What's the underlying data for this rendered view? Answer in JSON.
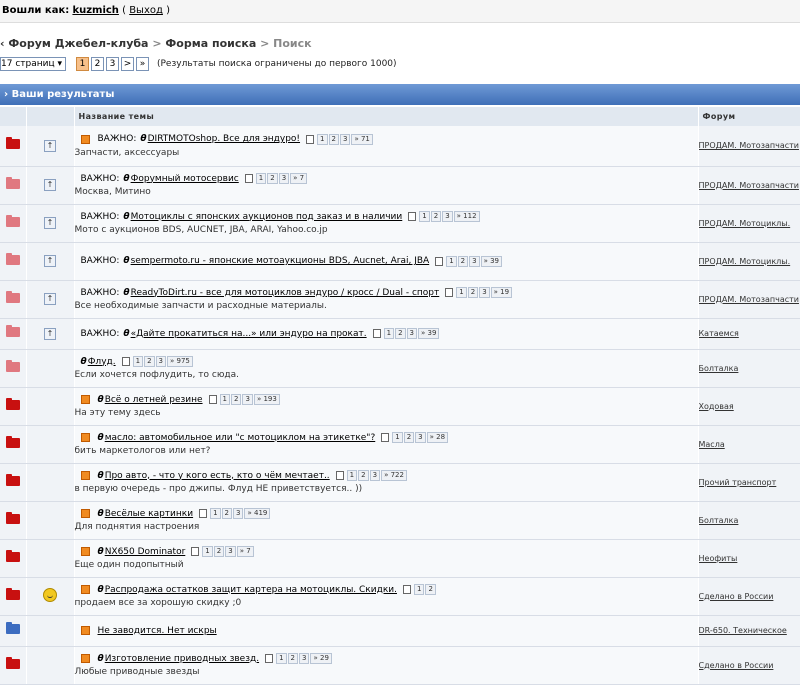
{
  "login": {
    "prefix": "Вошли как:",
    "user": "kuzmich",
    "logout": "Выход"
  },
  "breadcrumb": {
    "lead": "‹ ",
    "items": [
      "Форум Джебел-клуба",
      "Форма поиска"
    ],
    "current": "Поиск"
  },
  "pager": {
    "select_label": "17 страниц ▾",
    "pages": [
      "1",
      "2",
      "3",
      ">",
      "»"
    ],
    "current": "1",
    "note": "(Результаты поиска ограничены до первого 1000)"
  },
  "results": {
    "header": "› Ваши результаты"
  },
  "table": {
    "col_topic": "Название темы",
    "col_forum": "Форум"
  },
  "topics": [
    {
      "icon": "hot",
      "mark": "sticky",
      "new": true,
      "prefix": "ВАЖНО:",
      "poll": true,
      "title": "DIRTMOTOshop. Все для эндуро!",
      "pages": [
        "1",
        "2",
        "3",
        "» 71"
      ],
      "desc": "Запчасти, аксессуары",
      "forum": "ПРОДАМ. Мотозапчасти"
    },
    {
      "icon": "pink",
      "mark": "sticky",
      "new": false,
      "prefix": "ВАЖНО:",
      "poll": true,
      "title": "Форумный мотосервис",
      "pages": [
        "1",
        "2",
        "3",
        "» 7"
      ],
      "desc": "Москва, Митино",
      "forum": "ПРОДАМ. Мотозапчасти"
    },
    {
      "icon": "pink",
      "mark": "sticky",
      "new": false,
      "prefix": "ВАЖНО:",
      "poll": true,
      "title": "Мотоциклы с японских аукционов под заказ и в наличии",
      "pages": [
        "1",
        "2",
        "3",
        "» 112"
      ],
      "desc": "Мото с аукционов BDS, AUCNET, JBA, ARAI, Yahoo.co.jp",
      "forum": "ПРОДАМ. Мотоциклы."
    },
    {
      "icon": "pink",
      "mark": "sticky",
      "new": false,
      "prefix": "ВАЖНО:",
      "poll": true,
      "title": "sempermoto.ru - японские мотоаукционы BDS, Aucnet, Arai, JBA",
      "pages": [
        "1",
        "2",
        "3",
        "» 39"
      ],
      "desc": "",
      "forum": "ПРОДАМ. Мотоциклы."
    },
    {
      "icon": "pink",
      "mark": "sticky",
      "new": false,
      "prefix": "ВАЖНО:",
      "poll": true,
      "title": "ReadyToDirt.ru - все для мотоциклов эндуро / кросс / Dual - спорт",
      "pages": [
        "1",
        "2",
        "3",
        "» 19"
      ],
      "desc": "Все необходимые запчасти и расходные материалы.",
      "forum": "ПРОДАМ. Мотозапчасти"
    },
    {
      "icon": "pink",
      "mark": "sticky",
      "new": false,
      "prefix": "ВАЖНО:",
      "poll": true,
      "title": "«Дайте прокатиться на...» или эндуро на прокат.",
      "pages": [
        "1",
        "2",
        "3",
        "» 39"
      ],
      "desc": "",
      "forum": "Катаемся"
    },
    {
      "icon": "pink",
      "mark": "",
      "new": false,
      "prefix": "",
      "poll": true,
      "title": "Флуд.",
      "pages": [
        "1",
        "2",
        "3",
        "» 975"
      ],
      "desc": "Если хочется пофлудить, то сюда.",
      "forum": "Болталка"
    },
    {
      "icon": "hot",
      "mark": "",
      "new": true,
      "prefix": "",
      "poll": true,
      "title": "Всё о летней резине",
      "pages": [
        "1",
        "2",
        "3",
        "» 193"
      ],
      "desc": "На эту тему здесь",
      "forum": "Ходовая"
    },
    {
      "icon": "hot",
      "mark": "",
      "new": true,
      "prefix": "",
      "poll": true,
      "title": "масло: автомобильное или \"с мотоциклом на этикетке\"?",
      "pages": [
        "1",
        "2",
        "3",
        "» 28"
      ],
      "desc": "бить маркетологов или нет?",
      "forum": "Масла"
    },
    {
      "icon": "hot",
      "mark": "",
      "new": true,
      "prefix": "",
      "poll": true,
      "title": "Про авто, - что у кого есть, кто о чём мечтает..",
      "pages": [
        "1",
        "2",
        "3",
        "» 722"
      ],
      "desc": "в первую очередь - про джипы. Флуд НЕ приветствуется.. ))",
      "forum": "Прочий транспорт"
    },
    {
      "icon": "hot",
      "mark": "",
      "new": true,
      "prefix": "",
      "poll": true,
      "title": "Весёлые картинки",
      "pages": [
        "1",
        "2",
        "3",
        "» 419"
      ],
      "desc": "Для поднятия настроения",
      "forum": "Болталка"
    },
    {
      "icon": "hot",
      "mark": "",
      "new": true,
      "prefix": "",
      "poll": true,
      "title": "NX650 Dominator",
      "pages": [
        "1",
        "2",
        "3",
        "» 7"
      ],
      "desc": "Еще один подопытный",
      "forum": "Неофиты"
    },
    {
      "icon": "hot",
      "mark": "smile",
      "new": true,
      "prefix": "",
      "poll": true,
      "title": "Распродажа остатков защит картера на мотоциклы. Скидки.",
      "pages": [
        "1",
        "2"
      ],
      "desc": "продаем все за хорошую скидку ;0",
      "forum": "Сделано в России"
    },
    {
      "icon": "blue",
      "mark": "",
      "new": true,
      "prefix": "",
      "poll": false,
      "title": "Не заводится. Нет искры",
      "pages": [],
      "desc": "",
      "forum": "DR-650. Техническое"
    },
    {
      "icon": "hot",
      "mark": "",
      "new": true,
      "prefix": "",
      "poll": true,
      "title": "Изготовление приводных звезд.",
      "pages": [
        "1",
        "2",
        "3",
        "» 29"
      ],
      "desc": "Любые приводные звезды",
      "forum": "Сделано в России"
    }
  ]
}
